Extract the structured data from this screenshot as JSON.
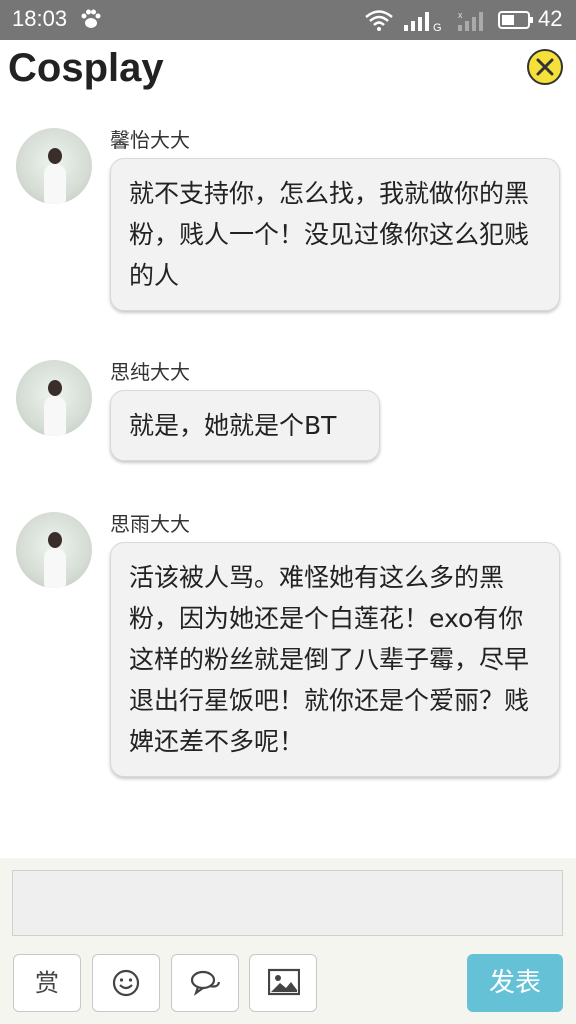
{
  "status_bar": {
    "time": "18:03",
    "network_type": "G",
    "battery_level": "42",
    "icons": [
      "paw-icon",
      "wifi-icon",
      "signal-icon",
      "signal-icon",
      "battery-icon"
    ]
  },
  "header": {
    "title": "Cosplay",
    "close_icon": "close-icon",
    "close_color": "#f5e13a"
  },
  "messages": [
    {
      "username": "馨怡大大",
      "text": "就不支持你，怎么找，我就做你的黑粉，贱人一个！没见过像你这么犯贱的人"
    },
    {
      "username": "思纯大大",
      "text": "就是，她就是个BT"
    },
    {
      "username": "思雨大大",
      "text": "活该被人骂。难怪她有这么多的黑粉，因为她还是个白莲花！exo有你这样的粉丝就是倒了八辈子霉，尽早退出行星饭吧！就你还是个爱丽？贱婢还差不多呢！"
    }
  ],
  "composer": {
    "input_value": "",
    "reward_label": "赏",
    "tools": [
      "smiley-icon",
      "chat-bubbles-icon",
      "image-icon"
    ],
    "send_label": "发表",
    "send_color": "#64c1d6"
  }
}
